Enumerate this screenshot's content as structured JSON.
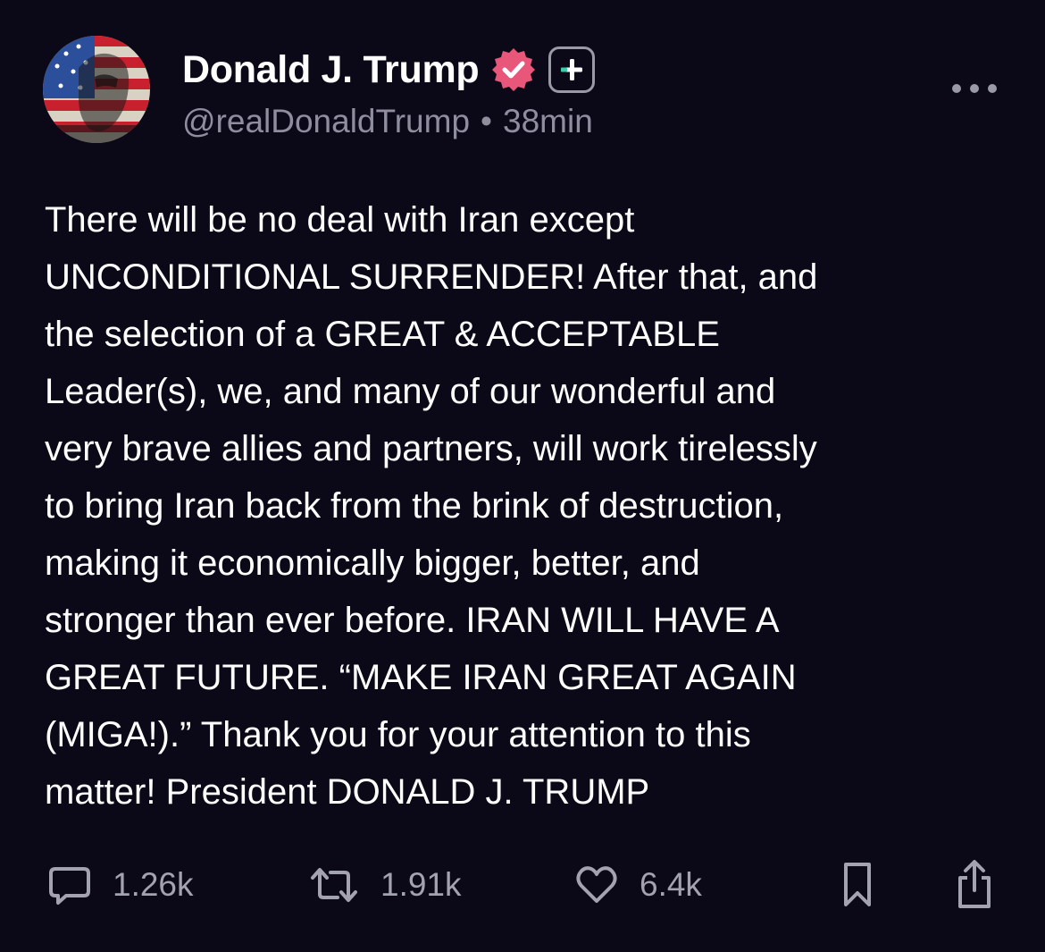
{
  "post": {
    "author": {
      "display_name": "Donald J. Trump",
      "handle": "@realDonaldTrump",
      "avatar_icon": "flag-portrait-avatar",
      "verified_icon": "verified-badge-icon",
      "plus_icon": "plus-square-icon"
    },
    "separator": "•",
    "timestamp": "38min",
    "text_lines": [
      "There will be no deal with Iran except",
      "UNCONDITIONAL SURRENDER! After that, and",
      "the selection of a GREAT & ACCEPTABLE",
      "Leader(s), we, and many of our wonderful and",
      "very brave allies and partners, will work tirelessly",
      "to bring Iran back from the brink of destruction,",
      "making it economically bigger, better, and",
      "stronger than ever before. IRAN WILL HAVE A",
      "GREAT FUTURE. “MAKE IRAN GREAT AGAIN",
      "(MIGA!).” Thank you for your attention to this",
      "matter! President DONALD J. TRUMP"
    ],
    "actions": {
      "replies": "1.26k",
      "reposts": "1.91k",
      "likes": "6.4k"
    }
  },
  "colors": {
    "background": "#0b0818",
    "text": "#ffffff",
    "muted": "#8f8e9e",
    "verified": "#e8577a",
    "plus_accent": "#35d0a8"
  }
}
